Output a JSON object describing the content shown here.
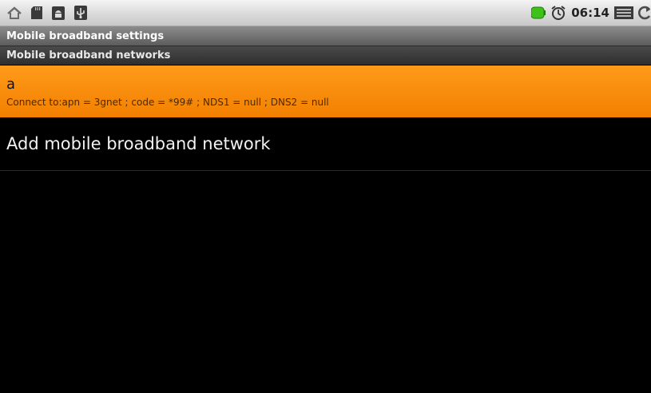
{
  "status_bar": {
    "left_icons": [
      "home-icon",
      "sd-card-icon",
      "android-debug-icon",
      "usb-icon"
    ],
    "right_icons": [
      "battery-icon",
      "alarm-clock-icon",
      "signal-menu-icon",
      "sync-icon"
    ],
    "time": "06:14",
    "colors": {
      "battery": "#3ec21a"
    }
  },
  "title_bar": {
    "title": "Mobile broadband settings"
  },
  "category": {
    "label": "Mobile broadband networks"
  },
  "networks": [
    {
      "name": "a",
      "summary": "Connect to:apn = 3gnet ; code = *99# ; NDS1 = null ; DNS2 = null",
      "selected": true
    }
  ],
  "add_network": {
    "label": "Add mobile broadband network"
  },
  "colors": {
    "selected_bg": "#f28000",
    "background": "#000000"
  }
}
